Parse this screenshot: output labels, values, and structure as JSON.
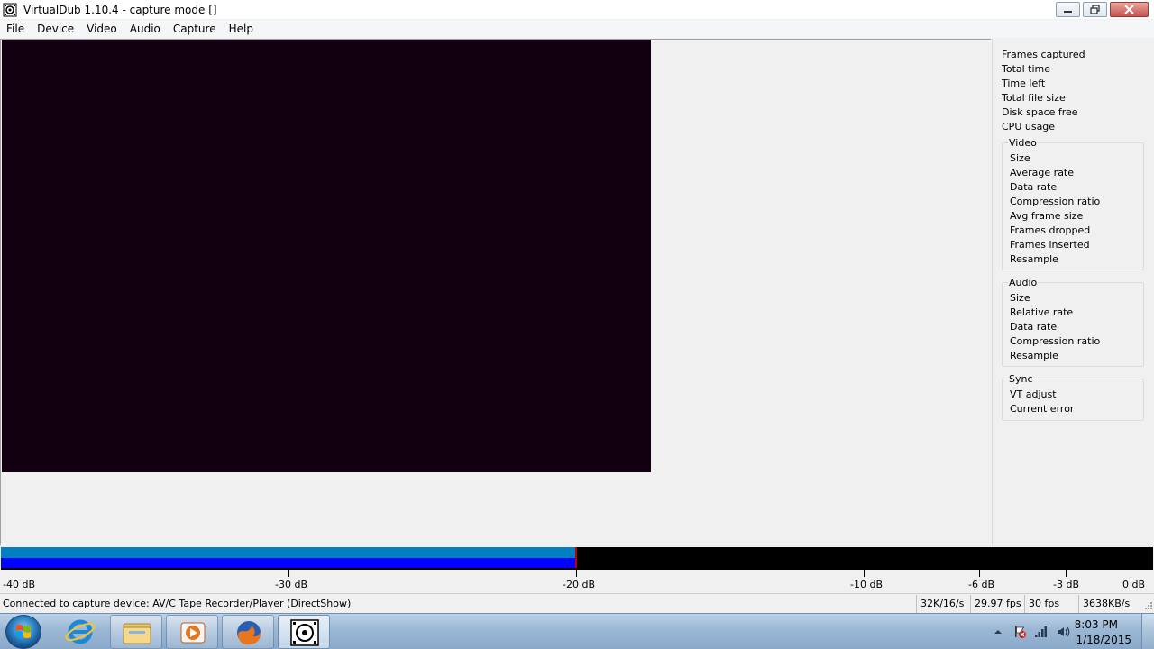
{
  "window": {
    "title": "VirtualDub 1.10.4 - capture mode []"
  },
  "menu": [
    "File",
    "Device",
    "Video",
    "Audio",
    "Capture",
    "Help"
  ],
  "stats": {
    "general": [
      "Frames captured",
      "Total time",
      "Time left",
      "Total file size",
      "Disk space free",
      "CPU usage"
    ],
    "video_title": "Video",
    "video": [
      "Size",
      "Average rate",
      "Data rate",
      "Compression ratio",
      "Avg frame size",
      "Frames dropped",
      "Frames inserted",
      "Resample"
    ],
    "audio_title": "Audio",
    "audio": [
      "Size",
      "Relative rate",
      "Data rate",
      "Compression ratio",
      "Resample"
    ],
    "sync_title": "Sync",
    "sync": [
      "VT adjust",
      "Current error"
    ]
  },
  "meter": {
    "labels": [
      "-40 dB",
      "-30 dB",
      "-20 dB",
      "-10 dB",
      "-6 dB",
      "-3 dB",
      "0 dB"
    ],
    "level_db": -20,
    "colors": {
      "fill_top": "#0080c0",
      "fill_bottom": "#0000ff",
      "peak": "#c00000",
      "background": "#000000"
    }
  },
  "status": {
    "message": "Connected to capture device: AV/C Tape Recorder/Player (DirectShow)",
    "audio_format": "32K/16/s",
    "fps": "29.97 fps",
    "fps_target": "30 fps",
    "data_rate": "3638KB/s"
  },
  "taskbar": {
    "time": "8:03 PM",
    "date": "1/18/2015",
    "apps": [
      "internet-explorer",
      "file-explorer",
      "media-player",
      "firefox",
      "virtualdub"
    ]
  }
}
